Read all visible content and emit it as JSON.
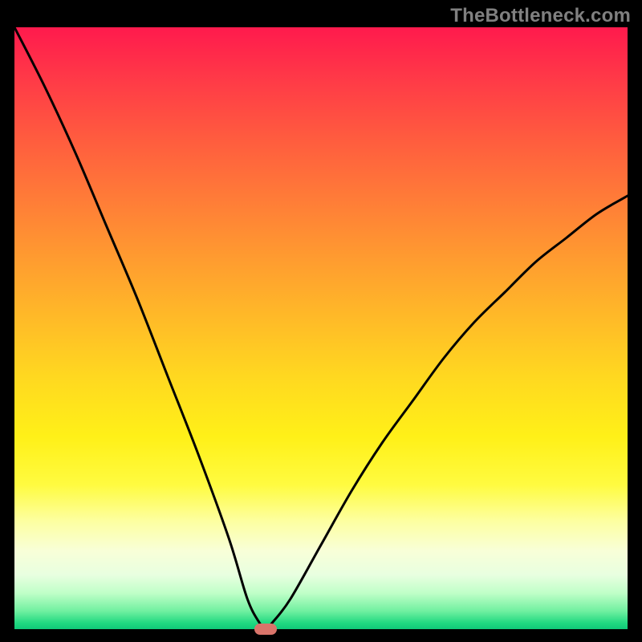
{
  "watermark": "TheBottleneck.com",
  "chart_data": {
    "type": "line",
    "title": "",
    "xlabel": "",
    "ylabel": "",
    "xlim": [
      0,
      100
    ],
    "ylim": [
      0,
      100
    ],
    "series": [
      {
        "name": "bottleneck-curve",
        "x": [
          0,
          5,
          10,
          15,
          20,
          25,
          30,
          35,
          38,
          40,
          41,
          42,
          45,
          50,
          55,
          60,
          65,
          70,
          75,
          80,
          85,
          90,
          95,
          100
        ],
        "values": [
          100,
          90,
          79,
          67,
          55,
          42,
          29,
          15,
          5,
          1,
          0,
          1,
          5,
          14,
          23,
          31,
          38,
          45,
          51,
          56,
          61,
          65,
          69,
          72
        ]
      }
    ],
    "marker": {
      "x": 41,
      "y": 0,
      "label": ""
    },
    "legend": false,
    "grid": false
  },
  "colors": {
    "curve": "#000000",
    "marker": "#d9746a"
  }
}
